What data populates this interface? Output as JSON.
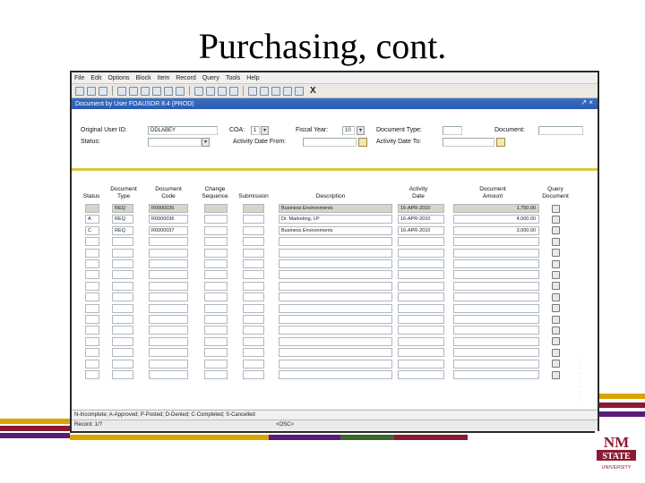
{
  "slide": {
    "title": "Purchasing, cont."
  },
  "colors": {
    "crimson": "#8a1a32",
    "gold": "#d9a400",
    "purple": "#5a1a7a",
    "green": "#3a6a2a",
    "titlebar": "#2a5bb0"
  },
  "menu": [
    "File",
    "Edit",
    "Options",
    "Block",
    "Item",
    "Record",
    "Query",
    "Tools",
    "Help"
  ],
  "window": {
    "title": "Document by User  FOAUSDR  8.4 (PROD)",
    "controls": "↗ ×"
  },
  "key_block": {
    "original_user_label": "Original User ID:",
    "original_user_value": "DDLABEY",
    "coa_label": "COA:",
    "coa_value": "1",
    "fiscal_year_label": "Fiscal Year:",
    "fiscal_year_value": "10",
    "doc_type_label": "Document Type:",
    "document_label": "Document:",
    "status_label": "Status:",
    "activity_from_label": "Activity Date From:",
    "activity_to_label": "Activity Date To:"
  },
  "table": {
    "headers": {
      "status": "Status",
      "doc_type": "Document\nType",
      "doc_code": "Document\nCode",
      "change_seq": "Change\nSequence",
      "submission": "Submission",
      "description": "Description",
      "activity_date": "Activity\nDate",
      "doc_amount": "Document\nAmount",
      "query_doc": "Query\nDocument"
    },
    "rows": [
      {
        "status": "",
        "type": "REQ",
        "code": "R0000036",
        "desc": "Business Environments",
        "date": "16-APR-2010",
        "amount": "1,750.00"
      },
      {
        "status": "A",
        "type": "REQ",
        "code": "R0000036",
        "desc": "Dr. Marketing, LP",
        "date": "16-APR-2010",
        "amount": "4,000.00"
      },
      {
        "status": "C",
        "type": "REQ",
        "code": "R0000037",
        "desc": "Business Environments",
        "date": "16-APR-2010",
        "amount": "3,000.00"
      }
    ]
  },
  "status": {
    "legend": "N-Incomplete; A-Approved; P-Posted; D-Denied; C-Completed; S-Cancelled",
    "record": "Record: 1/?",
    "osc": "<OSC>"
  }
}
